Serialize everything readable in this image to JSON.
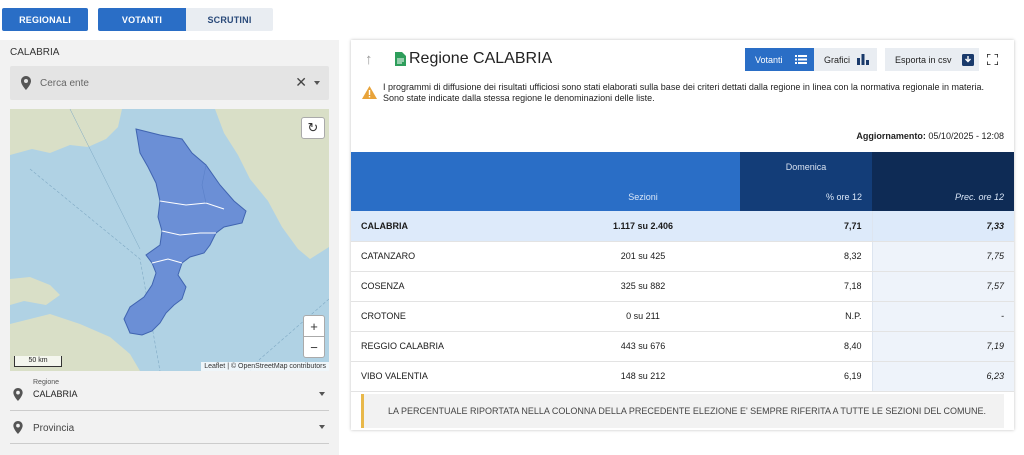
{
  "top_tabs": [
    {
      "label": "REGIONALI"
    },
    {
      "label": "VOTANTI"
    },
    {
      "label": "SCRUTINI"
    }
  ],
  "left_panel": {
    "region_title": "CALABRIA",
    "search_placeholder": "Cerca ente",
    "clear_symbol": "✕",
    "map": {
      "scale_label": "50 km",
      "attribution": "Leaflet | © OpenStreetMap contributors",
      "zoom_in": "+",
      "zoom_out": "−",
      "reset": "↻",
      "region_fill": "#6b8fd6"
    },
    "selects": [
      {
        "label": "Regione",
        "value": "CALABRIA"
      },
      {
        "label": "",
        "value": "Provincia"
      }
    ]
  },
  "panel": {
    "up_arrow": "↑",
    "title": "Regione CALABRIA",
    "buttons": {
      "votanti": "Votanti",
      "grafici": "Grafici",
      "csv": "Esporta in csv"
    },
    "notice_lines": [
      "I programmi di diffusione dei risultati ufficiosi sono stati elaborati sulla base dei criteri dettati dalla regione in linea con la normativa regionale in materia.",
      "Sono state indicate dalla stessa regione le denominazioni delle liste."
    ],
    "update_label": "Aggiornamento:",
    "update_value": "05/10/2025 - 12:08",
    "table": {
      "group_header": "Domenica",
      "columns": [
        "",
        "Sezioni",
        "% ore 12",
        "Prec. ore 12"
      ],
      "total_row": {
        "name": "CALABRIA",
        "sezioni": "1.117 su 2.406",
        "pct": "7,71",
        "prec": "7,33"
      },
      "rows": [
        {
          "name": "CATANZARO",
          "sezioni": "201 su 425",
          "pct": "8,32",
          "prec": "7,75"
        },
        {
          "name": "COSENZA",
          "sezioni": "325 su 882",
          "pct": "7,18",
          "prec": "7,57"
        },
        {
          "name": "CROTONE",
          "sezioni": "0 su 211",
          "pct": "N.P.",
          "prec": "-"
        },
        {
          "name": "REGGIO CALABRIA",
          "sezioni": "443 su 676",
          "pct": "8,40",
          "prec": "7,19"
        },
        {
          "name": "VIBO VALENTIA",
          "sezioni": "148 su 212",
          "pct": "6,19",
          "prec": "6,23"
        }
      ]
    },
    "footnote": "LA PERCENTUALE RIPORTATA NELLA COLONNA DELLA PRECEDENTE ELEZIONE E' SEMPRE RIFERITA A TUTTE LE SEZIONI DEL COMUNE."
  },
  "colors": {
    "accent": "#2a6ec6",
    "header_dark": "#133d78",
    "header_darker": "#0e2b55",
    "warning": "#e8a33a"
  }
}
